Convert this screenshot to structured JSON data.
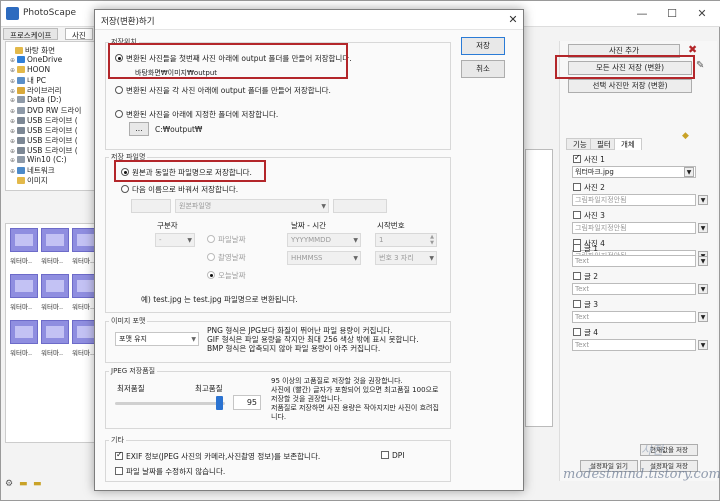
{
  "app": {
    "title": "PhotoScape",
    "tabs": [
      "프로스케이프",
      "사진"
    ],
    "window_controls": [
      "—",
      "☐",
      "✕"
    ]
  },
  "tree": {
    "items": [
      {
        "label": "바탕 화면",
        "expander": "",
        "icon": "folder-icon"
      },
      {
        "label": "OneDrive",
        "expander": "⊕",
        "icon": "cloud-icon"
      },
      {
        "label": "HOON",
        "expander": "⊕",
        "icon": "user-icon"
      },
      {
        "label": "내 PC",
        "expander": "⊕",
        "icon": "pc-icon"
      },
      {
        "label": "라이브러리",
        "expander": "⊕",
        "icon": "library-icon"
      },
      {
        "label": "Data (D:)",
        "expander": "⊕",
        "icon": "drive-icon"
      },
      {
        "label": "DVD RW 드라이",
        "expander": "⊕",
        "icon": "dvd-icon"
      },
      {
        "label": "USB 드라이브 (",
        "expander": "⊕",
        "icon": "usb-icon"
      },
      {
        "label": "USB 드라이브 (",
        "expander": "⊕",
        "icon": "usb-icon"
      },
      {
        "label": "USB 드라이브 (",
        "expander": "⊕",
        "icon": "usb-icon"
      },
      {
        "label": "USB 드라이브 (",
        "expander": "⊕",
        "icon": "usb-icon"
      },
      {
        "label": "Win10 (C:)",
        "expander": "⊕",
        "icon": "drive-icon"
      },
      {
        "label": "네트워크",
        "expander": "⊕",
        "icon": "network-icon"
      },
      {
        "label": "이미지",
        "expander": "",
        "icon": "folder-icon"
      }
    ]
  },
  "thumbs": [
    "워터마..",
    "워터마..",
    "워터마..",
    "워터마..",
    "워터마..",
    "워터마..",
    "워터마..",
    "워터마..",
    "워터마.."
  ],
  "right_panel": {
    "add_photo": "사진 추가",
    "save_all": "모든 사진 저장 (변환)",
    "save_selected": "선택 사진만 저장 (변환)",
    "tabs": [
      "기능",
      "필터",
      "개체"
    ],
    "photos": [
      {
        "label": "사진 1",
        "checked": true,
        "value": "워터마크.jpg",
        "placeholder": ""
      },
      {
        "label": "사진 2",
        "checked": false,
        "value": "",
        "placeholder": "그림파일지정안됨"
      },
      {
        "label": "사진 3",
        "checked": false,
        "value": "",
        "placeholder": "그림파일지정안됨"
      },
      {
        "label": "사진 4",
        "checked": false,
        "value": "",
        "placeholder": "그림파일지정안됨"
      }
    ],
    "texts": [
      {
        "label": "글 1",
        "placeholder": "Text"
      },
      {
        "label": "글 2",
        "placeholder": "Text"
      },
      {
        "label": "글 3",
        "placeholder": "Text"
      },
      {
        "label": "글 4",
        "placeholder": "Text"
      }
    ],
    "bottom_buttons": [
      "현재값을 저장",
      "설정파일 읽기",
      "설정파일 저장"
    ]
  },
  "dialog": {
    "title": "저장(변환)하기",
    "save_btn": "저장",
    "cancel_btn": "취소",
    "location_group": "저장위치",
    "opt_output_first": "변환된 사진들을 첫번째 사진 아래에 output 폴더를 만들어 저장합니다.",
    "opt_output_first_path": "바탕화면₩이미지₩output",
    "opt_output_each": "변환된 사진을 각 사진 아래에 output 폴더를 만들어 저장합니다.",
    "opt_specified": "변환된 사진을 아래에 지정한 폴더에 저장합니다.",
    "browse_btn": "...",
    "specified_path": "C:₩output₩",
    "filename_group": "저장 파일명",
    "opt_same_name": "원본과 동일한 파일명으로 저장합니다.",
    "opt_rename": "다음 이름으로 바꿔서 저장합니다.",
    "rename_select": "원본파일명",
    "separator_label": "구분자",
    "separator_value": "-",
    "date_labels": [
      "파일날짜",
      "촬영날짜",
      "오늘날짜"
    ],
    "datetime_label": "날짜 - 시간",
    "date_format": "YYYYMMDD",
    "time_format": "HHMMSS",
    "start_num_label": "시작번호",
    "start_num": "1",
    "digits": "번호 3 자리",
    "example": "예) test.jpg 는 test.jpg 파일명으로 변환됩니다.",
    "format_group": "이미지 포맷",
    "format_value": "포맷 유지",
    "format_desc": [
      "PNG 형식은 JPG보다 화질이 뛰어난 파일 용량이 커집니다.",
      "GIF 형식은 파일 용량을 작지만 최대 256 색상 밖에 표시 못합니다.",
      "BMP 형식은 압축되지 않아 파일 용량이 아주 커집니다."
    ],
    "jpeg_group": "JPEG 저장품질",
    "quality_low": "최저품질",
    "quality_high": "최고품질",
    "quality_value": "95",
    "quality_level": 0.95,
    "quality_desc": [
      "95 이상의 고품질로 저장할 것을 권장합니다.",
      "사진에 (빨간) 글자가 포함되어 있으면 최고품질 100으로",
      "저장할 것을 권장합니다.",
      "저품질로 저장하면 사진 용량은 작아지지만 사진이 흐려집",
      "니다."
    ],
    "etc_group": "기타",
    "exif_label": "EXIF 정보(JPEG 사진의 카메라,사진촬영 정보)를 보존합니다.",
    "exif_checked": true,
    "dpi_label": "DPI",
    "dpi_checked": false,
    "keep_date_label": "파일 날짜를 수정하지 않습니다.",
    "keep_date_checked": false
  },
  "watermark": "modestmind.tistory.com",
  "colors": {
    "highlight": "#b3262a",
    "accent": "#2b73d1",
    "thumb": "#8f8ee0"
  }
}
